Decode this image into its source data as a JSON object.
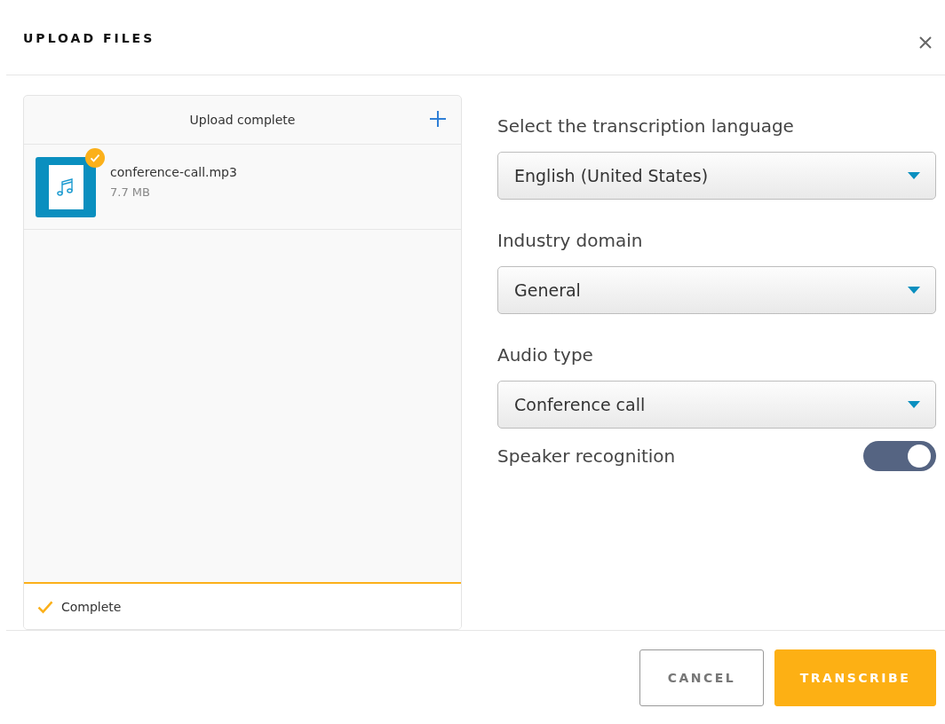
{
  "dialog": {
    "title": "UPLOAD FILES"
  },
  "upload_panel": {
    "status": "Upload complete",
    "files": [
      {
        "name": "conference-call.mp3",
        "size": "7.7 MB",
        "uploaded": true
      }
    ],
    "progress": {
      "level": 1,
      "label": "Complete"
    }
  },
  "settings": [
    {
      "kind": "select",
      "label": "Select the transcription language",
      "value": "English (United States)"
    },
    {
      "kind": "select",
      "label": "Industry domain",
      "value": "General"
    },
    {
      "kind": "select",
      "label": "Audio type",
      "value": "Conference call"
    },
    {
      "kind": "toggle",
      "label": "Speaker recognition",
      "on": true
    }
  ],
  "buttons": [
    {
      "label": "CANCEL",
      "kind": "secondary"
    },
    {
      "label": "TRANSCRIBE",
      "kind": "primary"
    }
  ]
}
